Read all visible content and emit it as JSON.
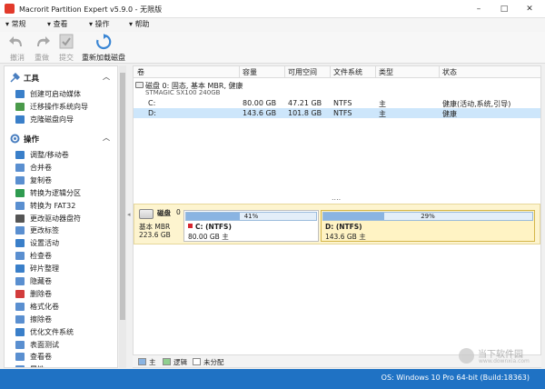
{
  "window": {
    "title": "Macrorit Partition Expert v5.9.0 - 无限版",
    "controls": [
      "–",
      "□",
      "✕"
    ]
  },
  "menu": [
    "常规",
    "查看",
    "操作",
    "帮助"
  ],
  "toolbar": {
    "undo": "撤消",
    "redo": "重做",
    "commit": "提交",
    "reload": "重新加载磁盘"
  },
  "sidebar": {
    "tools_header": "工具",
    "tools": [
      {
        "label": "创建可启动媒体",
        "color": "#3a7fc9"
      },
      {
        "label": "迁移操作系统向导",
        "color": "#4a9a4a"
      },
      {
        "label": "克隆磁盘向导",
        "color": "#3a7fc9"
      }
    ],
    "ops_header": "操作",
    "ops": [
      {
        "label": "调整/移动卷",
        "color": "#3a7fc9"
      },
      {
        "label": "合并卷",
        "color": "#5a8fd0"
      },
      {
        "label": "复制卷",
        "color": "#5a8fd0"
      },
      {
        "label": "转换为逻辑分区",
        "color": "#2f9b50"
      },
      {
        "label": "转换为 FAT32",
        "color": "#5a8fd0"
      },
      {
        "label": "更改驱动器盘符",
        "color": "#555555"
      },
      {
        "label": "更改标签",
        "color": "#5a8fd0"
      },
      {
        "label": "设置活动",
        "color": "#3a7fc9"
      },
      {
        "label": "检查卷",
        "color": "#5a8fd0"
      },
      {
        "label": "碎片整理",
        "color": "#3a7fc9"
      },
      {
        "label": "隐藏卷",
        "color": "#5a8fd0"
      },
      {
        "label": "删除卷",
        "color": "#d23c3c"
      },
      {
        "label": "格式化卷",
        "color": "#5a8fd0"
      },
      {
        "label": "擦除卷",
        "color": "#5a8fd0"
      },
      {
        "label": "优化文件系统",
        "color": "#3a7fc9"
      },
      {
        "label": "表面测试",
        "color": "#5a8fd0"
      },
      {
        "label": "查看卷",
        "color": "#5a8fd0"
      },
      {
        "label": "属性",
        "color": "#5a8fd0"
      }
    ]
  },
  "table": {
    "columns": [
      "卷",
      "容量",
      "可用空间",
      "文件系统",
      "类型",
      "状态"
    ],
    "disk": {
      "title": "磁盘 0: 固态, 基本 MBR, 健康",
      "model": "STMAGIC SX100 240GB"
    },
    "rows": [
      {
        "vol": "C:",
        "capacity": "80.00 GB",
        "free": "47.21 GB",
        "fs": "NTFS",
        "type": "主",
        "status": "健康(活动,系统,引导)",
        "selected": false
      },
      {
        "vol": "D:",
        "capacity": "143.6 GB",
        "free": "101.8 GB",
        "fs": "NTFS",
        "type": "主",
        "status": "健康",
        "selected": true
      }
    ],
    "splitter": "...."
  },
  "diskmap": {
    "disk_label": "磁盘",
    "disk_num": "0",
    "style": "基本 MBR",
    "size": "223.6 GB",
    "partitions": [
      {
        "pct_label": "41%",
        "used": 0.41,
        "name": "C: (NTFS)",
        "detail": "80.00 GB 主"
      },
      {
        "pct_label": "29%",
        "used": 0.29,
        "name": "D: (NTFS)",
        "detail": "143.6 GB 主"
      }
    ]
  },
  "legend": [
    {
      "label": "主",
      "color": "#8ab4e2"
    },
    {
      "label": "逻辑",
      "color": "#8fcf8f"
    },
    {
      "label": "未分配",
      "color": "#ffffff"
    }
  ],
  "status": {
    "os": "OS: Windows 10 Pro 64-bit (Build:18363)"
  },
  "watermark": {
    "text": "当下软件园",
    "url": "www.downxia.com"
  }
}
